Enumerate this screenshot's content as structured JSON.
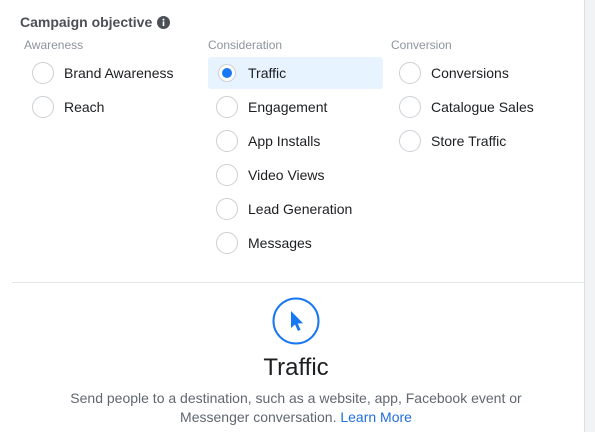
{
  "objective": {
    "title": "Campaign objective"
  },
  "columns": {
    "awareness": {
      "header": "Awareness",
      "options": [
        "Brand Awareness",
        "Reach"
      ]
    },
    "consideration": {
      "header": "Consideration",
      "options": [
        "Traffic",
        "Engagement",
        "App Installs",
        "Video Views",
        "Lead Generation",
        "Messages"
      ]
    },
    "conversion": {
      "header": "Conversion",
      "options": [
        "Conversions",
        "Catalogue Sales",
        "Store Traffic"
      ]
    }
  },
  "selected_option": "Traffic",
  "detail": {
    "icon": "cursor-icon",
    "title": "Traffic",
    "description": "Send people to a destination, such as a website, app, Facebook event or Messenger conversation.",
    "learn_more": "Learn More"
  },
  "colors": {
    "accent": "#1877f2",
    "selected_bg": "#e7f3ff",
    "link": "#216fdb"
  }
}
